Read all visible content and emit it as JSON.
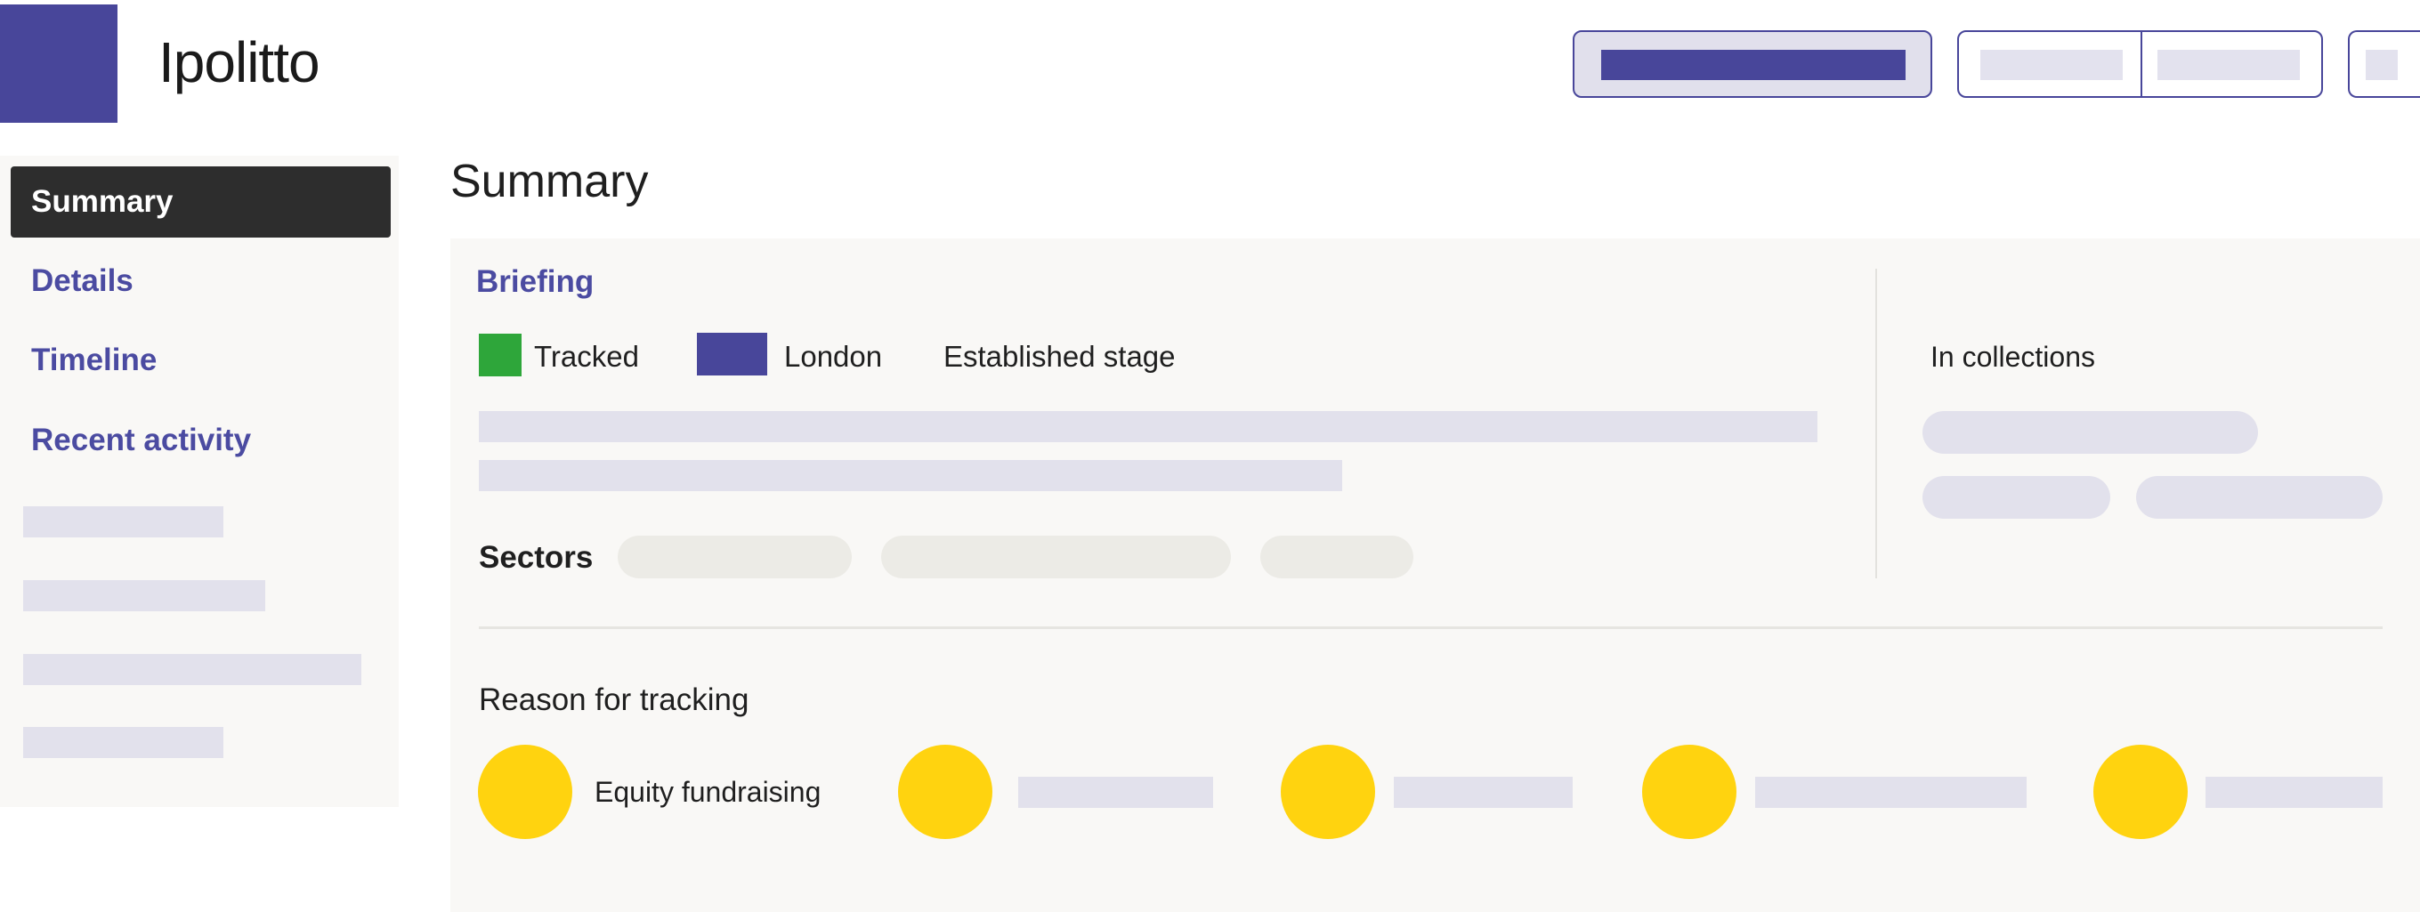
{
  "app": {
    "title": "Ipolitto"
  },
  "sidebar": {
    "items": [
      {
        "label": "Summary",
        "active": true
      },
      {
        "label": "Details"
      },
      {
        "label": "Timeline"
      },
      {
        "label": "Recent activity"
      }
    ]
  },
  "main": {
    "heading": "Summary",
    "briefing": {
      "title": "Briefing",
      "tags": [
        {
          "label": "Tracked",
          "color": "#2ea63a"
        },
        {
          "label": "London",
          "color": "#48469a"
        },
        {
          "label": "Established stage"
        }
      ],
      "sectors_label": "Sectors"
    },
    "collections": {
      "label": "In collections"
    },
    "reasons": {
      "label": "Reason for tracking",
      "items": [
        {
          "label": "Equity fundraising"
        }
      ]
    }
  },
  "colors": {
    "brand": "#48469a",
    "active_nav_bg": "#2d2d2d",
    "reason_icon": "#ffd30f",
    "placeholder": "#e2e1ec",
    "chip": "#ecebe6",
    "card_bg": "#f9f8f6"
  }
}
